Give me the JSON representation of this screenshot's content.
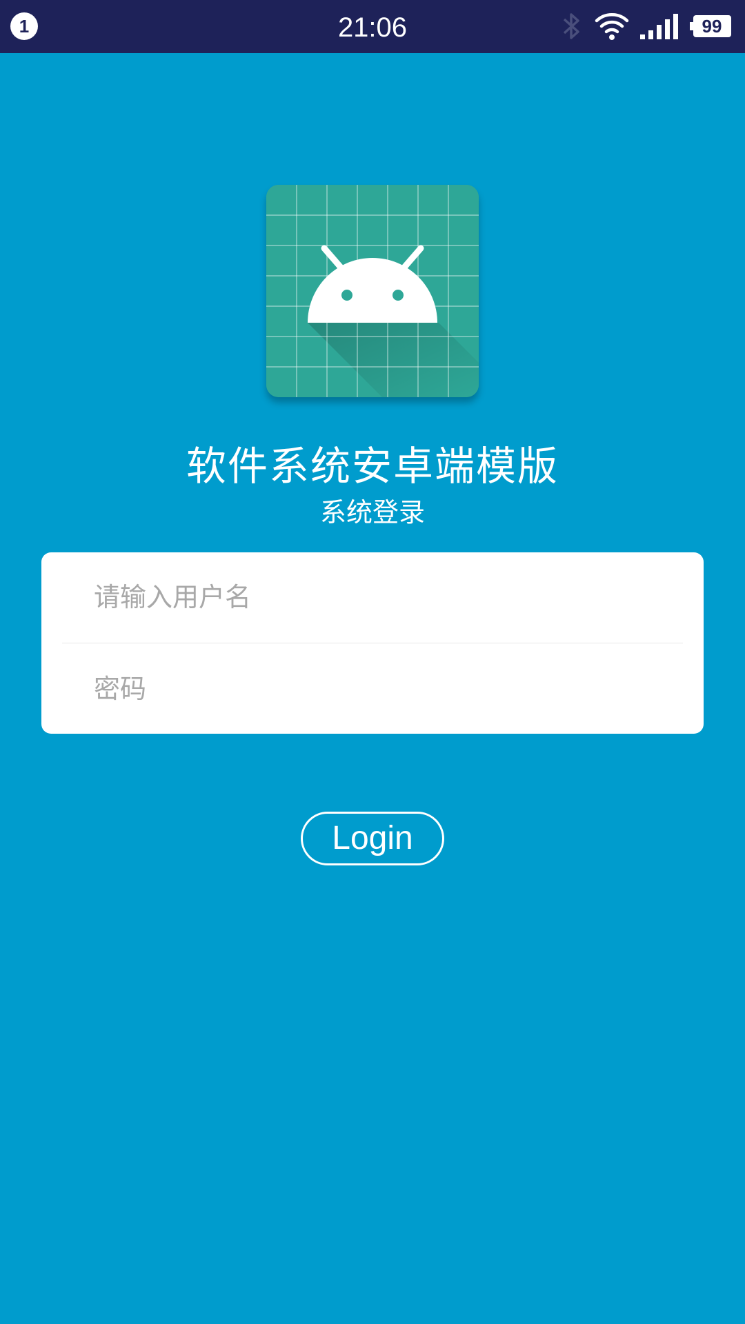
{
  "status_bar": {
    "notification_count": "1",
    "time": "21:06",
    "battery_level": "99",
    "icons": [
      "bluetooth-icon",
      "wifi-icon",
      "signal-icon",
      "battery-icon"
    ]
  },
  "app": {
    "icon": "android-icon",
    "title": "软件系统安卓端模版",
    "subtitle": "系统登录"
  },
  "form": {
    "username_placeholder": "请输入用户名",
    "username_value": "",
    "password_placeholder": "密码",
    "password_value": ""
  },
  "login_button": {
    "label": "Login"
  },
  "colors": {
    "background": "#009ccd",
    "status_bar": "#1e2259",
    "app_icon": "#2ea797",
    "card": "#ffffff",
    "placeholder": "#a8a8a8"
  }
}
